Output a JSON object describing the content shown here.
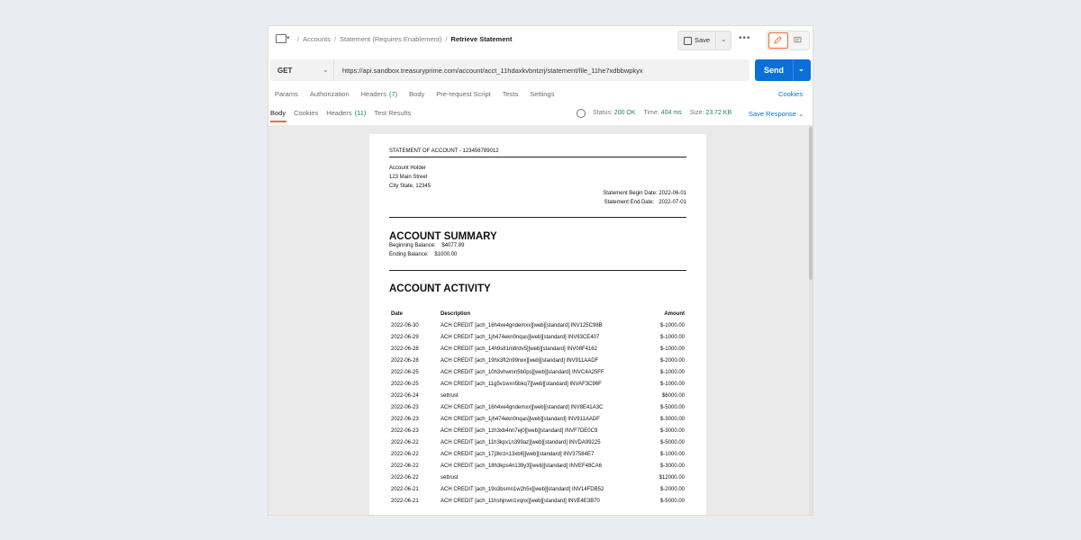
{
  "breadcrumb": {
    "items": [
      "Accounts",
      "Statement (Requires Enablement)"
    ],
    "current": "Retrieve Statement",
    "separator": "/"
  },
  "toolbar": {
    "save_label": "Save",
    "more_label": "•••"
  },
  "request": {
    "method": "GET",
    "url": "https://api.sandbox.treasuryprime.com/account/acct_11hdaxkvbntzrj/statement/file_11he7xdbbwpkyx",
    "send_label": "Send",
    "tabs": [
      {
        "label": "Params"
      },
      {
        "label": "Authorization"
      },
      {
        "label": "Headers",
        "count": "(7)"
      },
      {
        "label": "Body"
      },
      {
        "label": "Pre-request Script"
      },
      {
        "label": "Tests"
      },
      {
        "label": "Settings"
      }
    ],
    "cookies_label": "Cookies"
  },
  "response": {
    "tabs": [
      {
        "label": "Body"
      },
      {
        "label": "Cookies"
      },
      {
        "label": "Headers",
        "count": "(11)"
      },
      {
        "label": "Test Results"
      }
    ],
    "status_label": "Status:",
    "status_value": "200 OK",
    "time_label": "Time:",
    "time_value": "404 ms",
    "size_label": "Size:",
    "size_value": "23.72 KB",
    "save_response_label": "Save Response"
  },
  "statement": {
    "title": "STATEMENT OF ACCOUNT - 123456789012",
    "holder": [
      "Account Holder",
      "123 Main Street",
      "City State, 12345"
    ],
    "begin_date": "Statement Begin Date: 2022-06-01",
    "end_date": "Statement End Date:   2022-07-01",
    "summary_heading": "ACCOUNT SUMMARY",
    "beginning_balance": "Beginning Balance:    $4077.89",
    "ending_balance": "Ending Balance:    $1000.00",
    "activity_heading": "ACCOUNT ACTIVITY",
    "columns": {
      "date": "Date",
      "description": "Description",
      "amount": "Amount"
    },
    "rows": [
      {
        "date": "2022-06-30",
        "description": "ACH CREDIT [ach_16h4xe4gndemxx][web][standard] INV125C98B",
        "amount": "$-1000.00"
      },
      {
        "date": "2022-06-29",
        "description": "ACH CREDIT [ach_1jh474ekn0nqas][web][standard] INV83CE407",
        "amount": "$-1000.00"
      },
      {
        "date": "2022-06-28",
        "description": "ACH CREDIT [ach_14h9s81m8rdv5][web][standard] INV08F4162",
        "amount": "$-1000.00"
      },
      {
        "date": "2022-06-28",
        "description": "ACH CREDIT [ach_19hx3ft2n99rwx][web][standard] INV911AADF",
        "amount": "$-2000.00"
      },
      {
        "date": "2022-06-25",
        "description": "ACH CREDIT [ach_10h3vhwmn5b0ps][web][standard] INVC4A25FF",
        "amount": "$-1000.00"
      },
      {
        "date": "2022-06-25",
        "description": "ACH CREDIT [ach_11g5v1wxn5bkq7][web][standard] INVAF3C96F",
        "amount": "$-1000.00"
      },
      {
        "date": "2022-06-24",
        "description": "settrust",
        "amount": "$6000.00"
      },
      {
        "date": "2022-06-23",
        "description": "ACH CREDIT [ach_16h4xe4gndemxx][web][standard] INV8E41A3C",
        "amount": "$-5000.00"
      },
      {
        "date": "2022-06-23",
        "description": "ACH CREDIT [ach_1jh474ekn0nqas][web][standard] INV911AADF",
        "amount": "$-3000.00"
      },
      {
        "date": "2022-06-23",
        "description": "ACH CREDIT [ach_1zh3xb4nn7ej0][web][standard] INVF7DE0C9",
        "amount": "$-3000.00"
      },
      {
        "date": "2022-06-22",
        "description": "ACH CREDIT [ach_11h3kpx1n399az][web][standard] INVDA99225",
        "amount": "$-5000.00"
      },
      {
        "date": "2022-06-22",
        "description": "ACH CREDIT [ach_17j3krzn13xb6][web][standard] INV37584E7",
        "amount": "$-1000.00"
      },
      {
        "date": "2022-06-22",
        "description": "ACH CREDIT [ach_18h3kps4n139y3][web][standard] INVEF48CA6",
        "amount": "$-3000.00"
      },
      {
        "date": "2022-06-22",
        "description": "settrust",
        "amount": "$12000.00"
      },
      {
        "date": "2022-06-21",
        "description": "ACH CREDIT [ach_19o3bsmn1w2h5x][web][standard] INV14FDB52",
        "amount": "$-2000.00"
      },
      {
        "date": "2022-06-21",
        "description": "ACH CREDIT [ach_11hshjnwn1vqnx][web][standard] INVE4E3B70",
        "amount": "$-5000.00"
      }
    ]
  },
  "colors": {
    "accent_orange": "#f26b3a",
    "send_blue": "#0b6fd8",
    "status_green": "#1b8a4b"
  }
}
